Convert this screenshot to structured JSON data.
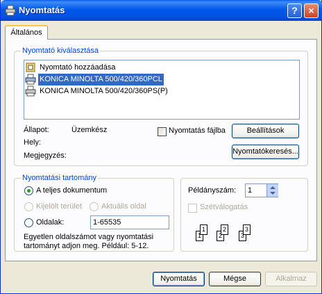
{
  "window": {
    "title": "Nyomtatás",
    "help_label": "?",
    "close_label": "×"
  },
  "tabs": [
    {
      "label": "Általános"
    }
  ],
  "printer_select": {
    "legend": "Nyomtató kiválasztása",
    "items": [
      {
        "label": "Nyomtató hozzáadása",
        "icon": "add-printer-icon"
      },
      {
        "label": "KONICA MINOLTA 500/420/360PCL",
        "icon": "printer-icon",
        "selected": true
      },
      {
        "label": "KONICA MINOLTA 500/420/360PS(P)",
        "icon": "printer-icon"
      }
    ],
    "status_label": "Állapot:",
    "status_value": "Üzemkész",
    "location_label": "Hely:",
    "comment_label": "Megjegyzés:",
    "print_to_file_label": "Nyomtatás fájlba",
    "preferences_button": "Beállítások",
    "find_printer_button": "Nyomtatókeresés..."
  },
  "page_range": {
    "legend": "Nyomtatási tartomány",
    "all_label": "A teljes dokumentum",
    "selection_label": "Kijelölt terület",
    "current_page_label": "Aktuális oldal",
    "pages_label": "Oldalak:",
    "pages_value": "1-65535",
    "hint_line1": "Egyetlen oldalszámot vagy nyomtatási",
    "hint_line2": "tartományt adjon meg. Például: 5-12."
  },
  "copies": {
    "label": "Példányszám:",
    "value": "1",
    "collate_label": "Szétválogatás",
    "collate_pages": [
      "1",
      "1",
      "2",
      "2",
      "3",
      "3"
    ]
  },
  "footer": {
    "print_button": "Nyomtatás",
    "cancel_button": "Mégse",
    "apply_button": "Alkalmaz"
  }
}
